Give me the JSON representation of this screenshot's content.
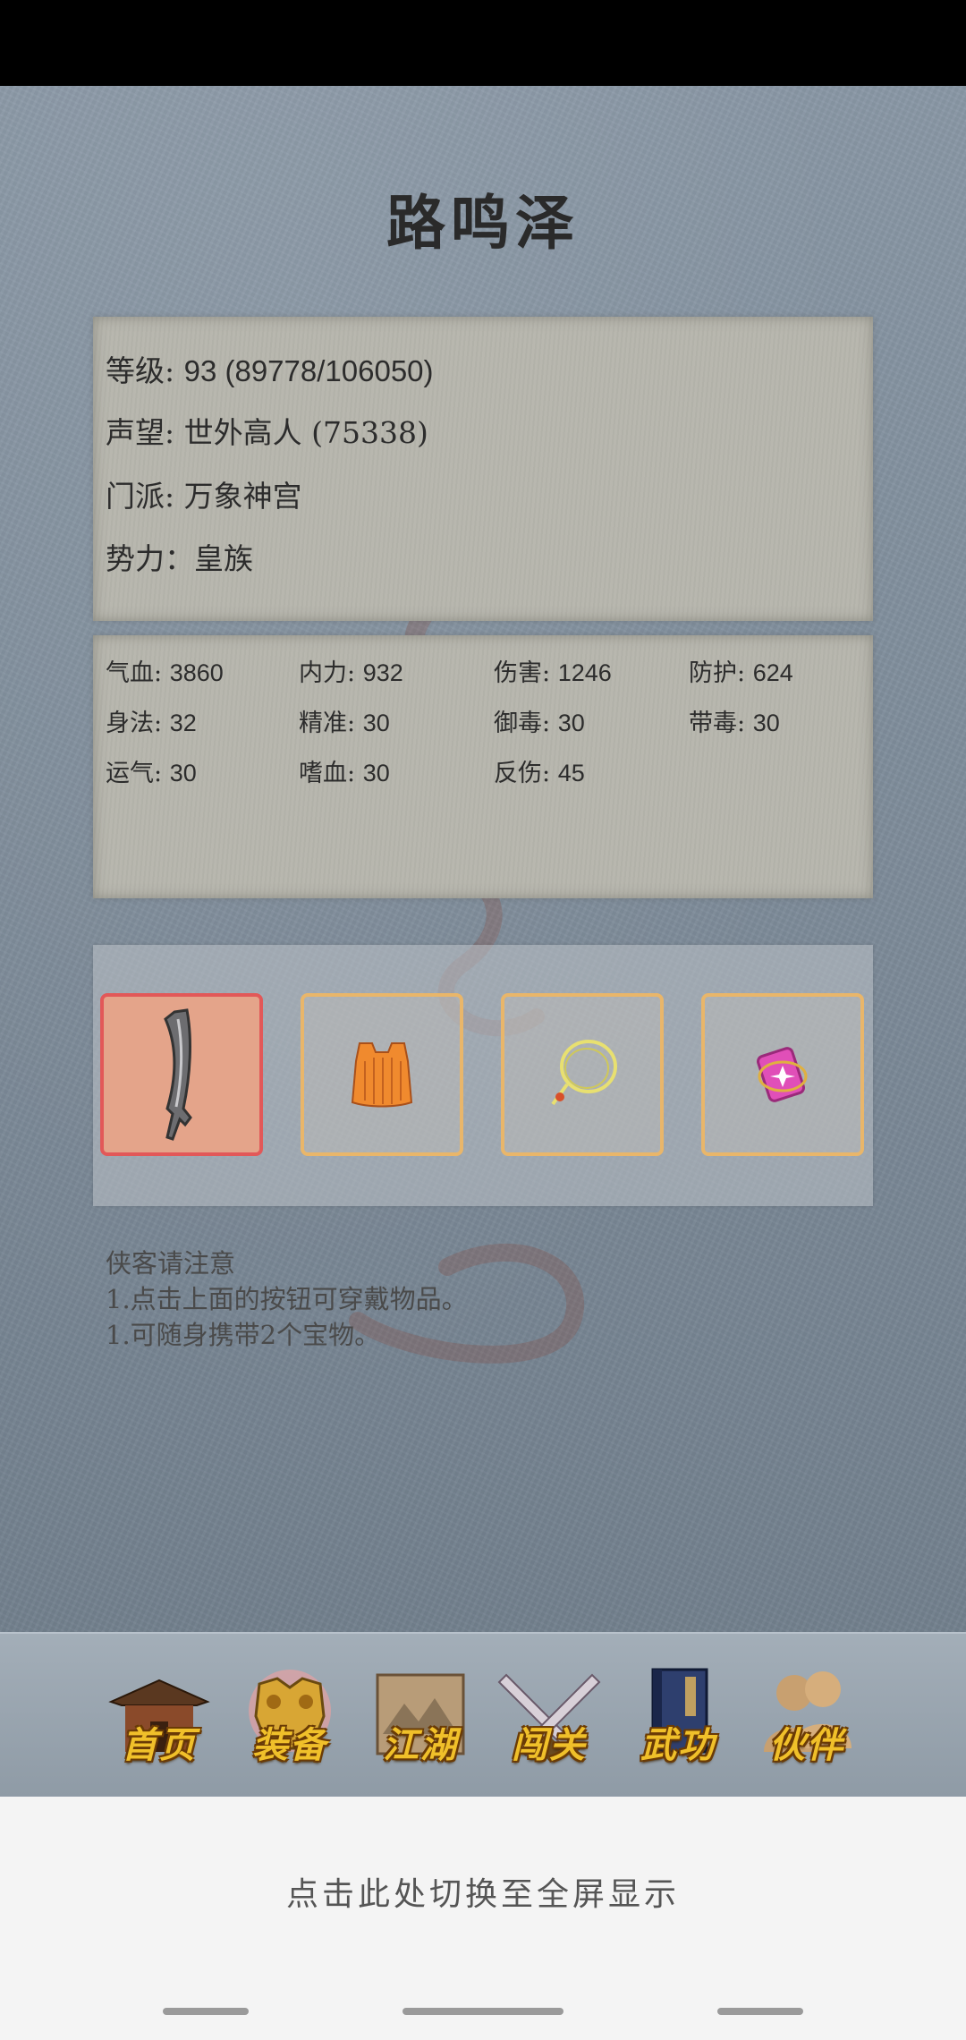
{
  "player": {
    "name": "路鸣泽"
  },
  "info": {
    "level_label": "等级: ",
    "level_value": "93 (89778/106050)",
    "reputation_label": "声望: ",
    "reputation_value": "世外高人 (75338)",
    "sect_label": "门派: ",
    "sect_value": "万象神宫",
    "faction_label": "势力：",
    "faction_value": "皇族"
  },
  "stats": [
    {
      "label": "气血: ",
      "value": "3860"
    },
    {
      "label": "内力: ",
      "value": "932"
    },
    {
      "label": "伤害: ",
      "value": "1246"
    },
    {
      "label": "防护: ",
      "value": "624"
    },
    {
      "label": "身法: ",
      "value": "32"
    },
    {
      "label": "精准: ",
      "value": "30"
    },
    {
      "label": "御毒: ",
      "value": "30"
    },
    {
      "label": "带毒: ",
      "value": "30"
    },
    {
      "label": "运气: ",
      "value": "30"
    },
    {
      "label": "嗜血: ",
      "value": "30"
    },
    {
      "label": "反伤: ",
      "value": "45"
    }
  ],
  "equipment": [
    {
      "icon": "broadsword-icon",
      "selected": true
    },
    {
      "icon": "orange-armor-icon",
      "selected": false
    },
    {
      "icon": "jade-necklace-icon",
      "selected": false
    },
    {
      "icon": "pink-treasure-icon",
      "selected": false
    }
  ],
  "notice": {
    "title": "侠客请注意",
    "line1": "1.点击上面的按钮可穿戴物品。",
    "line2": "1.可随身携带2个宝物。"
  },
  "nav": [
    {
      "label": "首页",
      "icon": "temple-icon"
    },
    {
      "label": "装备",
      "icon": "armor-icon"
    },
    {
      "label": "江湖",
      "icon": "scroll-map-icon"
    },
    {
      "label": "闯关",
      "icon": "crossed-swords-icon"
    },
    {
      "label": "武功",
      "icon": "martial-book-icon"
    },
    {
      "label": "伙伴",
      "icon": "companions-icon"
    }
  ],
  "fullscreen": {
    "text": "点击此处切换至全屏显示"
  },
  "colors": {
    "background": "#7f8d9b",
    "paper": "#b6b5ac",
    "slot_border": "#e9b66a",
    "slot_selected_border": "#e25858",
    "nav_label": "#f0c02a"
  }
}
